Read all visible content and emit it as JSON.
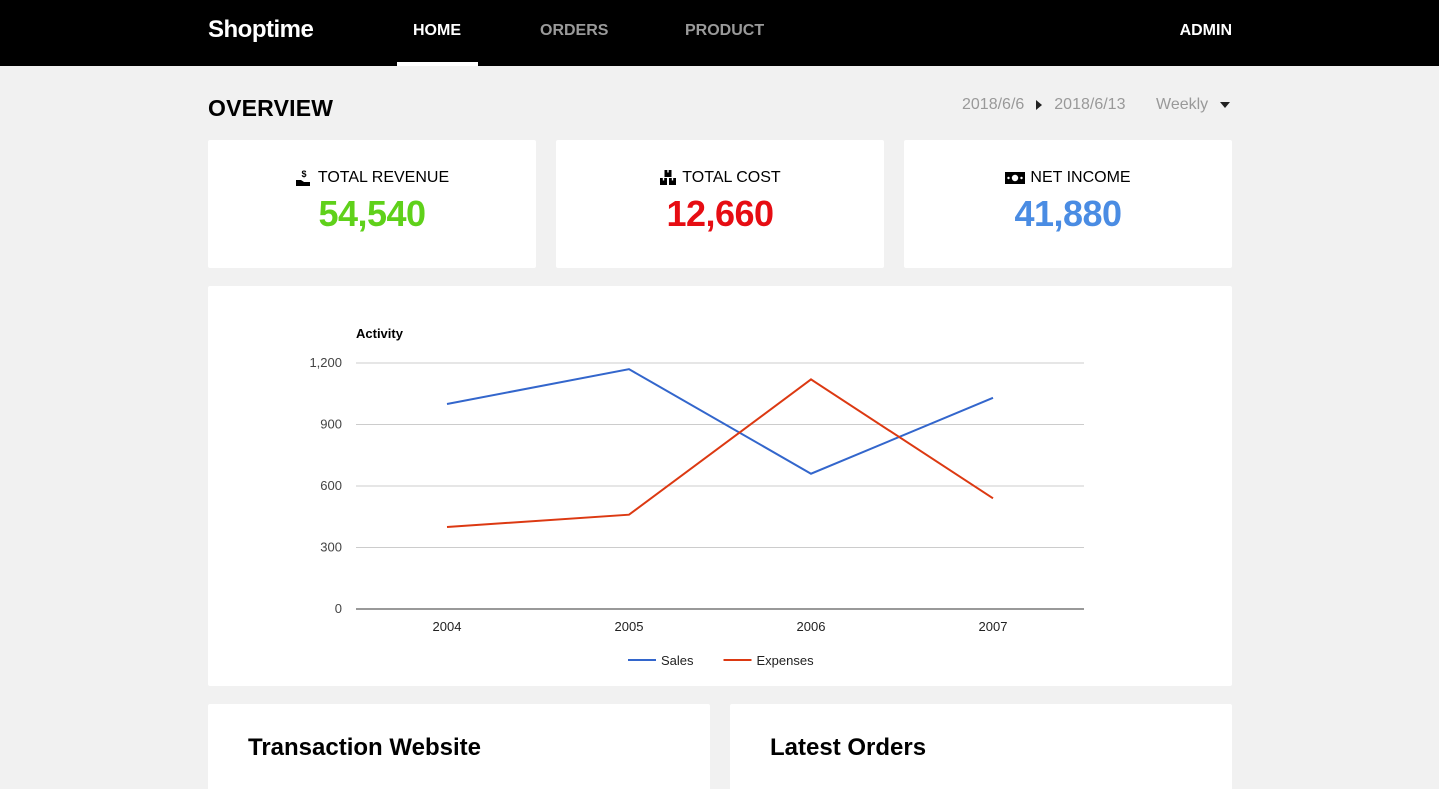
{
  "app": {
    "brand": "Shoptime",
    "nav": [
      {
        "label": "HOME",
        "active": true
      },
      {
        "label": "ORDERS",
        "active": false
      },
      {
        "label": "PRODUCT",
        "active": false
      }
    ],
    "user": "ADMIN"
  },
  "overview": {
    "title": "OVERVIEW",
    "date_start": "2018/6/6",
    "date_end": "2018/6/13",
    "period": "Weekly"
  },
  "stats": [
    {
      "icon": "hand-dollar-icon",
      "label": "TOTAL REVENUE",
      "value": "54,540",
      "color": "#5fd11a"
    },
    {
      "icon": "boxes-icon",
      "label": "TOTAL COST",
      "value": "12,660",
      "color": "#e60d13"
    },
    {
      "icon": "money-bill-icon",
      "label": "NET INCOME",
      "value": "41,880",
      "color": "#4a8ce3"
    }
  ],
  "chart_data": {
    "type": "line",
    "title": "Activity",
    "categories": [
      "2004",
      "2005",
      "2006",
      "2007"
    ],
    "series": [
      {
        "name": "Sales",
        "values": [
          1000,
          1170,
          660,
          1030
        ],
        "color": "#3366cc"
      },
      {
        "name": "Expenses",
        "values": [
          400,
          460,
          1120,
          540
        ],
        "color": "#dc3912"
      }
    ],
    "ylim": [
      0,
      1200
    ],
    "yticks": [
      "0",
      "300",
      "600",
      "900",
      "1,200"
    ],
    "ytick_values": [
      0,
      300,
      600,
      900,
      1200
    ],
    "grid": true,
    "legend": "bottom"
  },
  "panels": {
    "transactions_title": "Transaction Website",
    "orders_title": "Latest Orders"
  }
}
